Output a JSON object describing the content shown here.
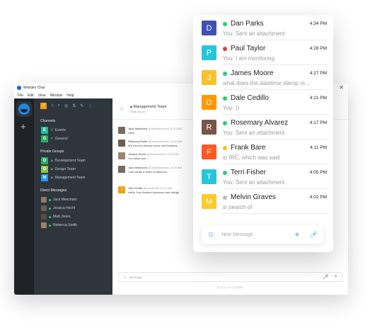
{
  "desktop": {
    "title": "Webdex Chat",
    "menu": [
      "File",
      "Edit",
      "View",
      "Window",
      "Help"
    ],
    "me_initial": "J",
    "channels_title": "Channels",
    "channels": [
      {
        "initial": "E",
        "label": "Events",
        "color": "#1abc9c"
      },
      {
        "initial": "G",
        "label": "General",
        "color": "#27ae60"
      }
    ],
    "groups_title": "Private Groups",
    "groups": [
      {
        "initial": "D",
        "label": "Development Team",
        "color": "#27ae60"
      },
      {
        "initial": "D",
        "label": "Design Team",
        "color": "#8bc34a"
      },
      {
        "initial": "M",
        "label": "Management Team",
        "color": "#2196f3"
      }
    ],
    "dm_title": "Direct Messages",
    "dms": [
      "Jack Meecham",
      "Jessica Hecht",
      "Matt Jones",
      "Rebecca Smith"
    ],
    "header_title": "Management Team",
    "header_sub": "Work Issues",
    "messages": [
      {
        "name": "Jack Meecham",
        "handle": "@JackMeecham 10:15 AM",
        "text": "Hello"
      },
      {
        "name": "Rebecca Smith",
        "handle": "@RebeccaSmith 10:16 AM",
        "text": "We need to discuss some new features."
      },
      {
        "name": "Jessica Hecht",
        "handle": "@JessicaHecht 10:19 AM",
        "text": "I'm ready now."
      },
      {
        "name": "Jack Meecham",
        "handle": "@JackMeecham 10:20 AM",
        "text": "I will create a video conference."
      },
      {
        "name": "John Smith",
        "handle": "@JohnSmith 10:21 AM",
        "text": "Hello! Just finished business card design",
        "initial": "J"
      }
    ],
    "composer_placeholder": "Message",
    "bottom_bar": "B   I   S   ◇   </>   ⟨⟩   CODE"
  },
  "mobile": {
    "contacts": [
      {
        "initial": "D",
        "name": "Dan Parks",
        "preview": "You: Sent an attachment",
        "time": "4:34 PM",
        "avatar_color": "#3f51b5",
        "status_color": "#2ecc71"
      },
      {
        "initial": "P",
        "name": "Paul Taylor",
        "preview": "You: I am monitoring",
        "time": "4:28 PM",
        "avatar_color": "#26c6da",
        "status_color": "#e53935"
      },
      {
        "initial": "J",
        "name": "James Moore",
        "preview": "what does the datetime stamp re...",
        "time": "4:27 PM",
        "avatar_color": "#fbc02d",
        "status_color": "#2ecc71"
      },
      {
        "initial": "D",
        "name": "Dale Cedillo",
        "preview": "You: ))",
        "time": "4:21 PM",
        "avatar_color": "#ff9800",
        "status_color": "#2ecc71"
      },
      {
        "initial": "R",
        "name": "Rosemary Alvarez",
        "preview": "You: Sent an attachment",
        "time": "4:17 PM",
        "avatar_color": "#795548",
        "status_color": "#2ecc71"
      },
      {
        "initial": "F",
        "name": "Frank Bare",
        "preview": "in IRC, which was said",
        "time": "4:11 PM",
        "avatar_color": "#ff5722",
        "status_color": "#f1c40f"
      },
      {
        "initial": "T",
        "name": "Terri Fisher",
        "preview": "You: Sent an attachment",
        "time": "4:05 PM",
        "avatar_color": "#26c6da",
        "status_color": "#2ecc71"
      },
      {
        "initial": "M",
        "name": "Melvin Graves",
        "preview": "in search of",
        "time": "4:02 PM",
        "avatar_color": "#ffca28",
        "status_color": "#bdbdbd"
      }
    ],
    "composer_placeholder": "New Message"
  }
}
